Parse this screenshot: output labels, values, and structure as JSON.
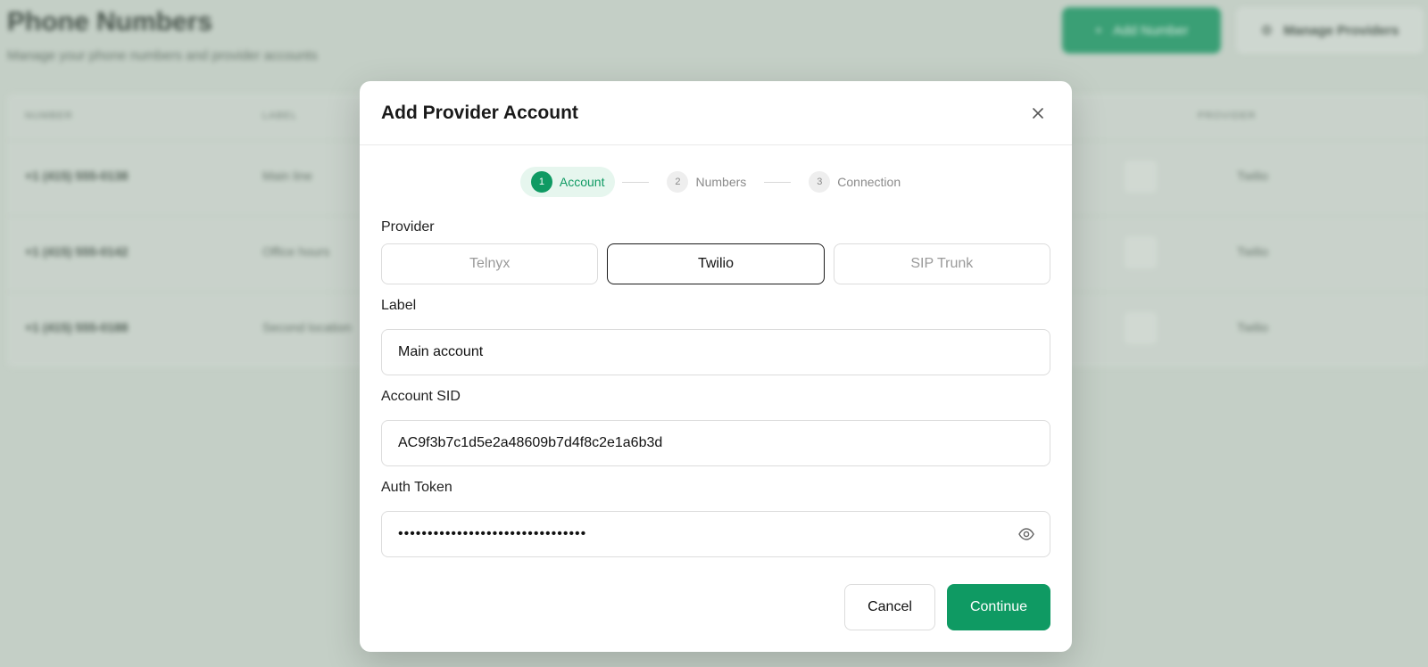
{
  "background": {
    "title": "Phone Numbers",
    "subtitle": "Manage your phone numbers and provider accounts",
    "add_number_label": "Add Number",
    "manage_providers_label": "Manage Providers",
    "table_headers": [
      "NUMBER",
      "LABEL",
      "PROVIDER"
    ],
    "rows": [
      {
        "number": "+1 (415) 555-0138",
        "label": "Main line",
        "provider": "Twilio"
      },
      {
        "number": "+1 (415) 555-0142",
        "label": "Office hours",
        "provider": "Twilio"
      },
      {
        "number": "+1 (415) 555-0188",
        "label": "Second location",
        "provider": "Twilio"
      }
    ]
  },
  "modal": {
    "title": "Add Provider Account",
    "steps": [
      {
        "num": "1",
        "label": "Account",
        "active": true
      },
      {
        "num": "2",
        "label": "Numbers",
        "active": false
      },
      {
        "num": "3",
        "label": "Connection",
        "active": false
      }
    ],
    "provider_label": "Provider",
    "providers": [
      {
        "name": "Telnyx",
        "selected": false
      },
      {
        "name": "Twilio",
        "selected": true
      },
      {
        "name": "SIP Trunk",
        "selected": false
      }
    ],
    "label_field": {
      "label": "Label",
      "value": "Main account"
    },
    "sid_field": {
      "label": "Account SID",
      "value": "AC9f3b7c1d5e2a48609b7d4f8c2e1a6b3d"
    },
    "token_field": {
      "label": "Auth Token",
      "value": "••••••••••••••••••••••••••••••••"
    },
    "cancel_label": "Cancel",
    "continue_label": "Continue"
  },
  "colors": {
    "accent": "#0f9a63",
    "accent_light": "#e6f6ee",
    "overlay": "#c4cfc6"
  }
}
